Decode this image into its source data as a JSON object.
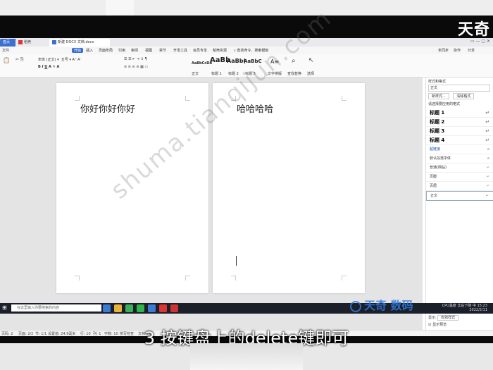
{
  "brand_logo": "天奇",
  "tabs": [
    {
      "label": "首页"
    },
    {
      "label": "稻壳"
    },
    {
      "label": "新建 DOCX 文档.docx"
    }
  ],
  "menu": {
    "file": "文件",
    "items": [
      "开始",
      "插入",
      "页面布局",
      "引用",
      "审阅",
      "视图",
      "章节",
      "开发工具",
      "会员专享",
      "稻壳资源"
    ],
    "active": "开始",
    "search": "查找命令、搜索模板",
    "right": [
      "未同步",
      "协作",
      "分享"
    ]
  },
  "ribbon": {
    "styles": [
      {
        "preview": "AaBbCcDd",
        "name": "正文"
      },
      {
        "preview": "AaBb",
        "name": "标题 1"
      },
      {
        "preview": "AaBb(",
        "name": "标题 2"
      },
      {
        "preview": "AaBbC",
        "name": "标题 3"
      }
    ],
    "tools": [
      "文字排版",
      "查找替换",
      "选择"
    ]
  },
  "pages": [
    {
      "text": "你好你好你好"
    },
    {
      "text": "哈哈哈哈"
    }
  ],
  "styles_panel": {
    "title": "样式和格式",
    "current": "正文",
    "buttons": [
      "新样式...",
      "清除格式"
    ],
    "hint": "请选择要应用的格式",
    "items": [
      "标题 1",
      "标题 2",
      "标题 3",
      "标题 4",
      "超链接",
      "默认段落字体",
      "普通(网站)",
      "页脚",
      "页眉",
      "正文"
    ],
    "show_label": "显示:",
    "show_value": "有效样式",
    "preview": "显示预览"
  },
  "status": [
    "页码: 2",
    "页面: 2/2",
    "节: 1/1",
    "设置值: 24.9毫米",
    "行: 10",
    "列: 1",
    "字数: 10",
    "拼写检查",
    "文档校对"
  ],
  "taskbar": {
    "search_placeholder": "在这里输入你要搜索的内容",
    "time": "15:23",
    "date": "2022/2/11",
    "cpu": "CPU温度",
    "weather": "比右下降",
    "lang": "中"
  },
  "watermark": "shuma.tianqijun.com",
  "watermark_logo": "天奇 数码",
  "caption": "3 按键盘上的delete键即可"
}
